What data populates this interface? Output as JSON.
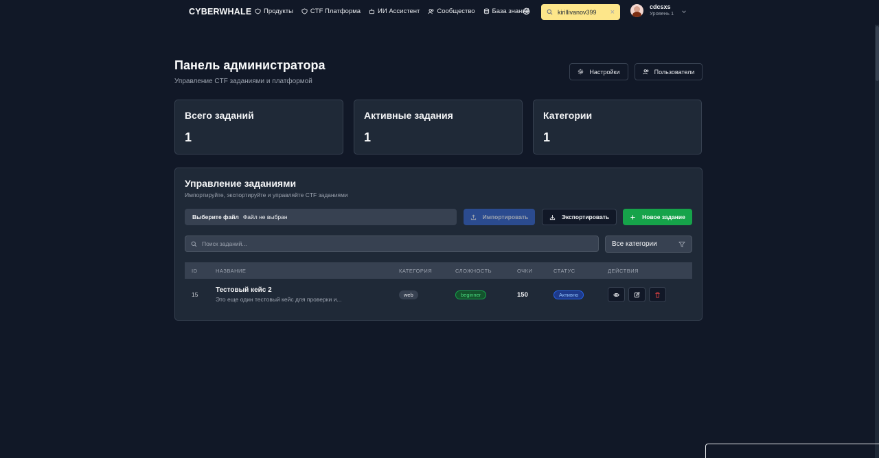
{
  "nav": {
    "logo": "CYBERWHALE",
    "links": [
      {
        "label": "Продукты",
        "icon": "shield-icon"
      },
      {
        "label": "CTF Платформа",
        "icon": "shield-icon"
      },
      {
        "label": "ИИ Ассистент",
        "icon": "bot-icon"
      },
      {
        "label": "Сообщество",
        "icon": "users-icon"
      },
      {
        "label": "База знаний",
        "icon": "database-icon"
      }
    ],
    "search_value": "kirillivanov399",
    "user": {
      "name": "cdcsxs",
      "level": "Уровень 1"
    }
  },
  "header": {
    "title": "Панель администратора",
    "subtitle": "Управление CTF заданиями и платформой",
    "settings_label": "Настройки",
    "users_label": "Пользователи"
  },
  "stats": [
    {
      "label": "Всего заданий",
      "value": "1"
    },
    {
      "label": "Активные задания",
      "value": "1"
    },
    {
      "label": "Категории",
      "value": "1"
    }
  ],
  "panel": {
    "title": "Управление заданиями",
    "subtitle": "Импортируйте, экспортируйте и управляйте CTF заданиями",
    "file_choose": "Выберите файл",
    "file_none": "Файл не выбран",
    "import_label": "Импортировать",
    "export_label": "Экспортировать",
    "new_label": "Новое задание",
    "search_placeholder": "Поиск заданий...",
    "category_selected": "Все категории"
  },
  "table": {
    "headers": [
      "ID",
      "НАЗВАНИЕ",
      "КАТЕГОРИЯ",
      "СЛОЖНОСТЬ",
      "ОЧКИ",
      "СТАТУС",
      "ДЕЙСТВИЯ"
    ],
    "rows": [
      {
        "id": "15",
        "title": "Тестовый кейс 2",
        "description": "Это еще один тестовый кейс для проверки и...",
        "category": "web",
        "difficulty": "beginner",
        "points": "150",
        "status": "Активно"
      }
    ]
  },
  "colors": {
    "background": "#111827",
    "card": "#1f2937",
    "accent_green": "#16a34a",
    "accent_blue": "#2b4b8f",
    "search_highlight": "#fde68a"
  }
}
